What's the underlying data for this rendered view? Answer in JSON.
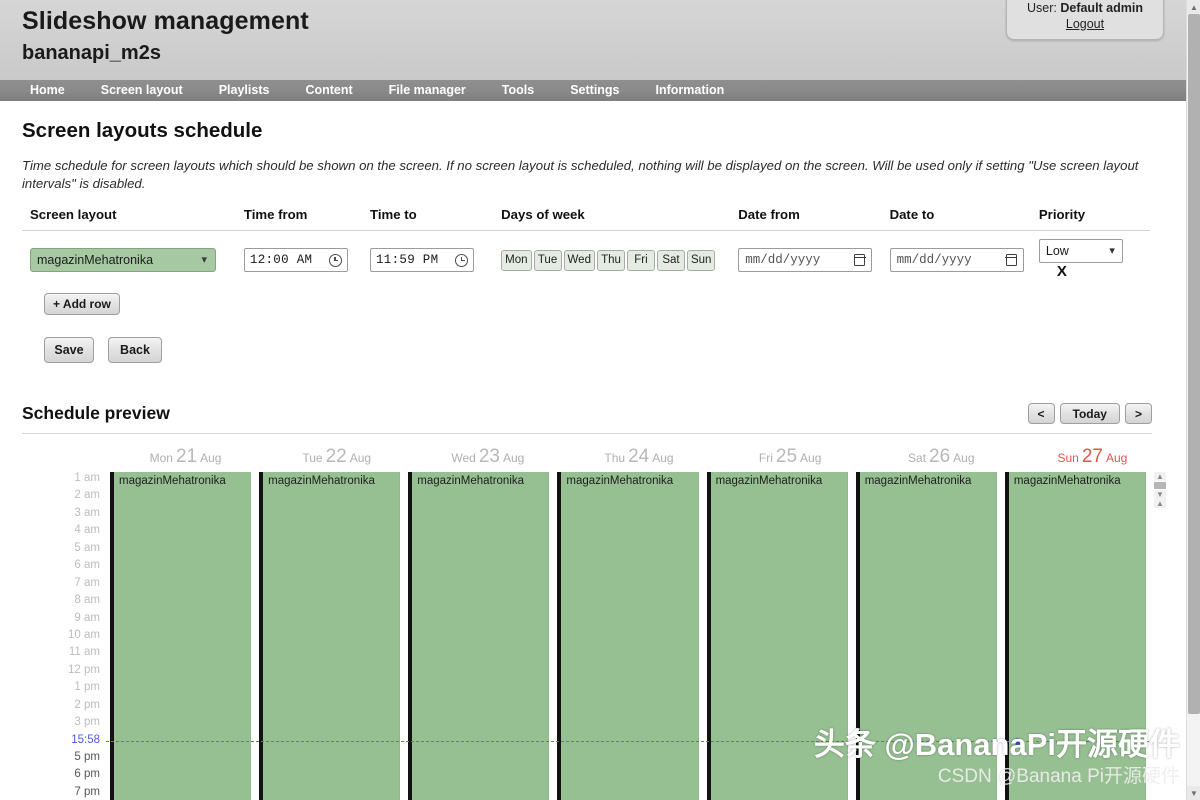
{
  "header": {
    "app_title": "Slideshow management",
    "device_name": "bananapi_m2s",
    "user_prefix": "User:",
    "user_name": "Default admin",
    "logout_label": "Logout"
  },
  "nav": {
    "items": [
      {
        "label": "Home"
      },
      {
        "label": "Screen layout"
      },
      {
        "label": "Playlists"
      },
      {
        "label": "Content"
      },
      {
        "label": "File manager"
      },
      {
        "label": "Tools"
      },
      {
        "label": "Settings"
      },
      {
        "label": "Information"
      }
    ]
  },
  "page": {
    "title": "Screen layouts schedule",
    "description": "Time schedule for screen layouts which should be shown on the screen. If no screen layout is scheduled, nothing will be displayed on the screen. Will be used only if setting \"Use screen layout intervals\" is disabled."
  },
  "schedule_table": {
    "columns": [
      "Screen layout",
      "Time from",
      "Time to",
      "Days of week",
      "Date from",
      "Date to",
      "Priority"
    ],
    "rows": [
      {
        "screen_layout": "magazinMehatronika",
        "time_from": "12:00 AM",
        "time_to": "11:59 PM",
        "days": [
          {
            "label": "Mon",
            "selected": true
          },
          {
            "label": "Tue",
            "selected": true
          },
          {
            "label": "Wed",
            "selected": true
          },
          {
            "label": "Thu",
            "selected": true
          },
          {
            "label": "Fri",
            "selected": true
          },
          {
            "label": "Sat",
            "selected": true
          },
          {
            "label": "Sun",
            "selected": true
          }
        ],
        "date_from_placeholder": "mm/dd/yyyy",
        "date_to_placeholder": "mm/dd/yyyy",
        "priority": "Low",
        "remove_label": "X"
      }
    ]
  },
  "buttons": {
    "add_row": "+ Add row",
    "save": "Save",
    "back": "Back"
  },
  "preview": {
    "title": "Schedule preview",
    "nav_prev": "<",
    "nav_today": "Today",
    "nav_next": ">"
  },
  "calendar": {
    "days": [
      {
        "dow": "Mon",
        "num": "21",
        "mon": "Aug",
        "is_today": false,
        "event": "magazinMehatronika"
      },
      {
        "dow": "Tue",
        "num": "22",
        "mon": "Aug",
        "is_today": false,
        "event": "magazinMehatronika"
      },
      {
        "dow": "Wed",
        "num": "23",
        "mon": "Aug",
        "is_today": false,
        "event": "magazinMehatronika"
      },
      {
        "dow": "Thu",
        "num": "24",
        "mon": "Aug",
        "is_today": false,
        "event": "magazinMehatronika"
      },
      {
        "dow": "Fri",
        "num": "25",
        "mon": "Aug",
        "is_today": false,
        "event": "magazinMehatronika"
      },
      {
        "dow": "Sat",
        "num": "26",
        "mon": "Aug",
        "is_today": false,
        "event": "magazinMehatronika"
      },
      {
        "dow": "Sun",
        "num": "27",
        "mon": "Aug",
        "is_today": true,
        "event": "magazinMehatronika"
      }
    ],
    "time_labels": [
      "1 am",
      "2 am",
      "3 am",
      "4 am",
      "5 am",
      "6 am",
      "7 am",
      "8 am",
      "9 am",
      "10 am",
      "11 am",
      "12 pm",
      "1 pm",
      "2 pm",
      "3 pm",
      "15:58",
      "5 pm",
      "6 pm",
      "7 pm"
    ],
    "current_time": "15:58",
    "event_color": "#96bf92",
    "today_color": "#e4534b",
    "now_color": "#4b5fd6"
  },
  "watermark": {
    "main": "头条 @BananaPi开源硬件",
    "sub": "CSDN @Banana Pi开源硬件"
  }
}
